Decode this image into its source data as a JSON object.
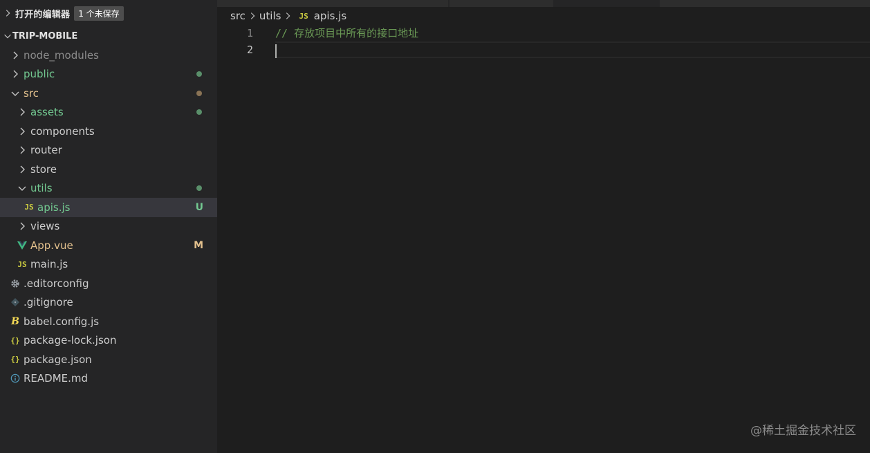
{
  "sidebar": {
    "open_editors": {
      "title": "打开的编辑器",
      "badge": "1 个未保存"
    },
    "project": {
      "name": "TRIP-MOBILE"
    },
    "items": [
      {
        "label": "node_modules",
        "indent": 0,
        "type": "folder",
        "expanded": false,
        "color": "#8c8c8c"
      },
      {
        "label": "public",
        "indent": 0,
        "type": "folder",
        "expanded": false,
        "color": "#73c991",
        "dot": "#5a8f6a"
      },
      {
        "label": "src",
        "indent": 0,
        "type": "folder",
        "expanded": true,
        "color": "#e2c08d",
        "dot": "#8a7355"
      },
      {
        "label": "assets",
        "indent": 1,
        "type": "folder",
        "expanded": false,
        "color": "#73c991",
        "dot": "#5a8f6a"
      },
      {
        "label": "components",
        "indent": 1,
        "type": "folder",
        "expanded": false,
        "color": "#cccccc"
      },
      {
        "label": "router",
        "indent": 1,
        "type": "folder",
        "expanded": false,
        "color": "#cccccc"
      },
      {
        "label": "store",
        "indent": 1,
        "type": "folder",
        "expanded": false,
        "color": "#cccccc"
      },
      {
        "label": "utils",
        "indent": 1,
        "type": "folder",
        "expanded": true,
        "color": "#73c991",
        "dot": "#5a8f6a"
      },
      {
        "label": "apis.js",
        "indent": 2,
        "type": "js",
        "color": "#73c991",
        "status": "U",
        "status_color": "#73c991",
        "selected": true
      },
      {
        "label": "views",
        "indent": 1,
        "type": "folder",
        "expanded": false,
        "color": "#cccccc"
      },
      {
        "label": "App.vue",
        "indent": 1,
        "type": "vue",
        "color": "#e2c08d",
        "status": "M",
        "status_color": "#e2c08d"
      },
      {
        "label": "main.js",
        "indent": 1,
        "type": "js",
        "color": "#cccccc"
      },
      {
        "label": ".editorconfig",
        "indent": 0,
        "type": "gear",
        "color": "#cccccc"
      },
      {
        "label": ".gitignore",
        "indent": 0,
        "type": "git",
        "color": "#cccccc"
      },
      {
        "label": "babel.config.js",
        "indent": 0,
        "type": "babel",
        "color": "#cccccc"
      },
      {
        "label": "package-lock.json",
        "indent": 0,
        "type": "json",
        "color": "#cccccc"
      },
      {
        "label": "package.json",
        "indent": 0,
        "type": "json",
        "color": "#cccccc"
      },
      {
        "label": "README.md",
        "indent": 0,
        "type": "info",
        "color": "#cccccc"
      }
    ]
  },
  "icons": {
    "js": "JS",
    "json": "{}"
  },
  "editor": {
    "breadcrumb": {
      "part1": "src",
      "part2": "utils",
      "file": "apis.js"
    },
    "lines": [
      {
        "number": "1",
        "text": "// 存放项目中所有的接口地址"
      },
      {
        "number": "2",
        "text": ""
      }
    ]
  },
  "watermark": "@稀土掘金技术社区"
}
